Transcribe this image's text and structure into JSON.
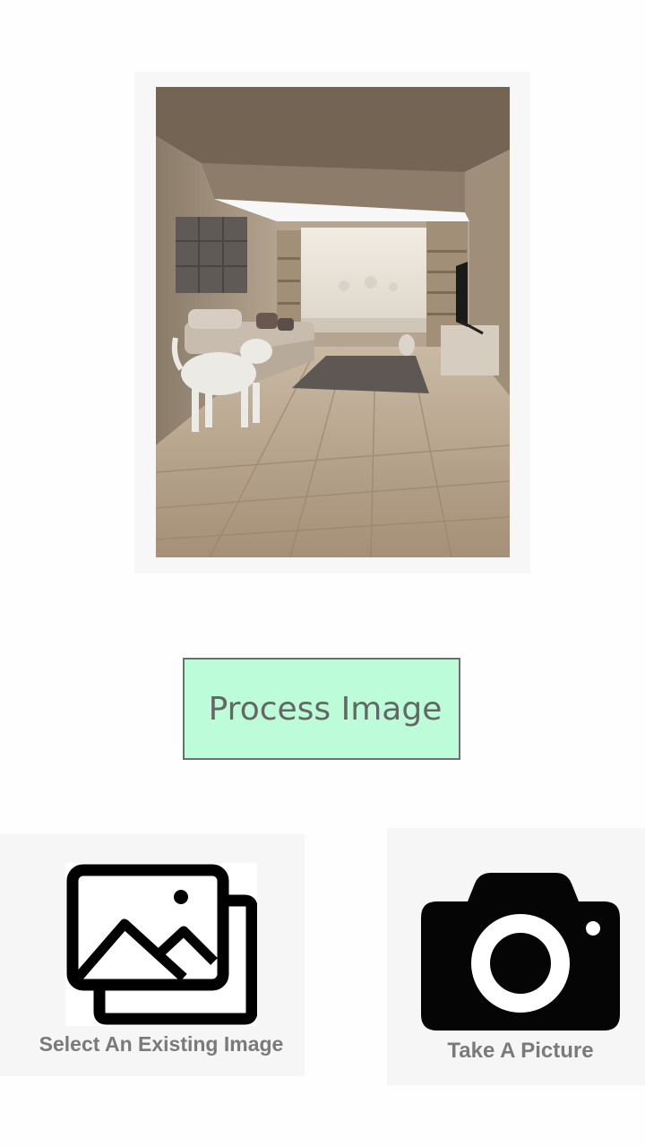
{
  "preview": {
    "image_subject": "living-room-photo"
  },
  "actions": {
    "process_label": "Process Image",
    "select_existing_label": "Select An Existing Image",
    "take_picture_label": "Take A Picture"
  },
  "icons": {
    "gallery": "gallery-icon",
    "camera": "camera-icon"
  },
  "colors": {
    "process_button_bg": "#bdfcd8",
    "process_button_border": "#6e6e6e",
    "label_gray": "#7a7a7a",
    "icon_black": "#000000"
  }
}
